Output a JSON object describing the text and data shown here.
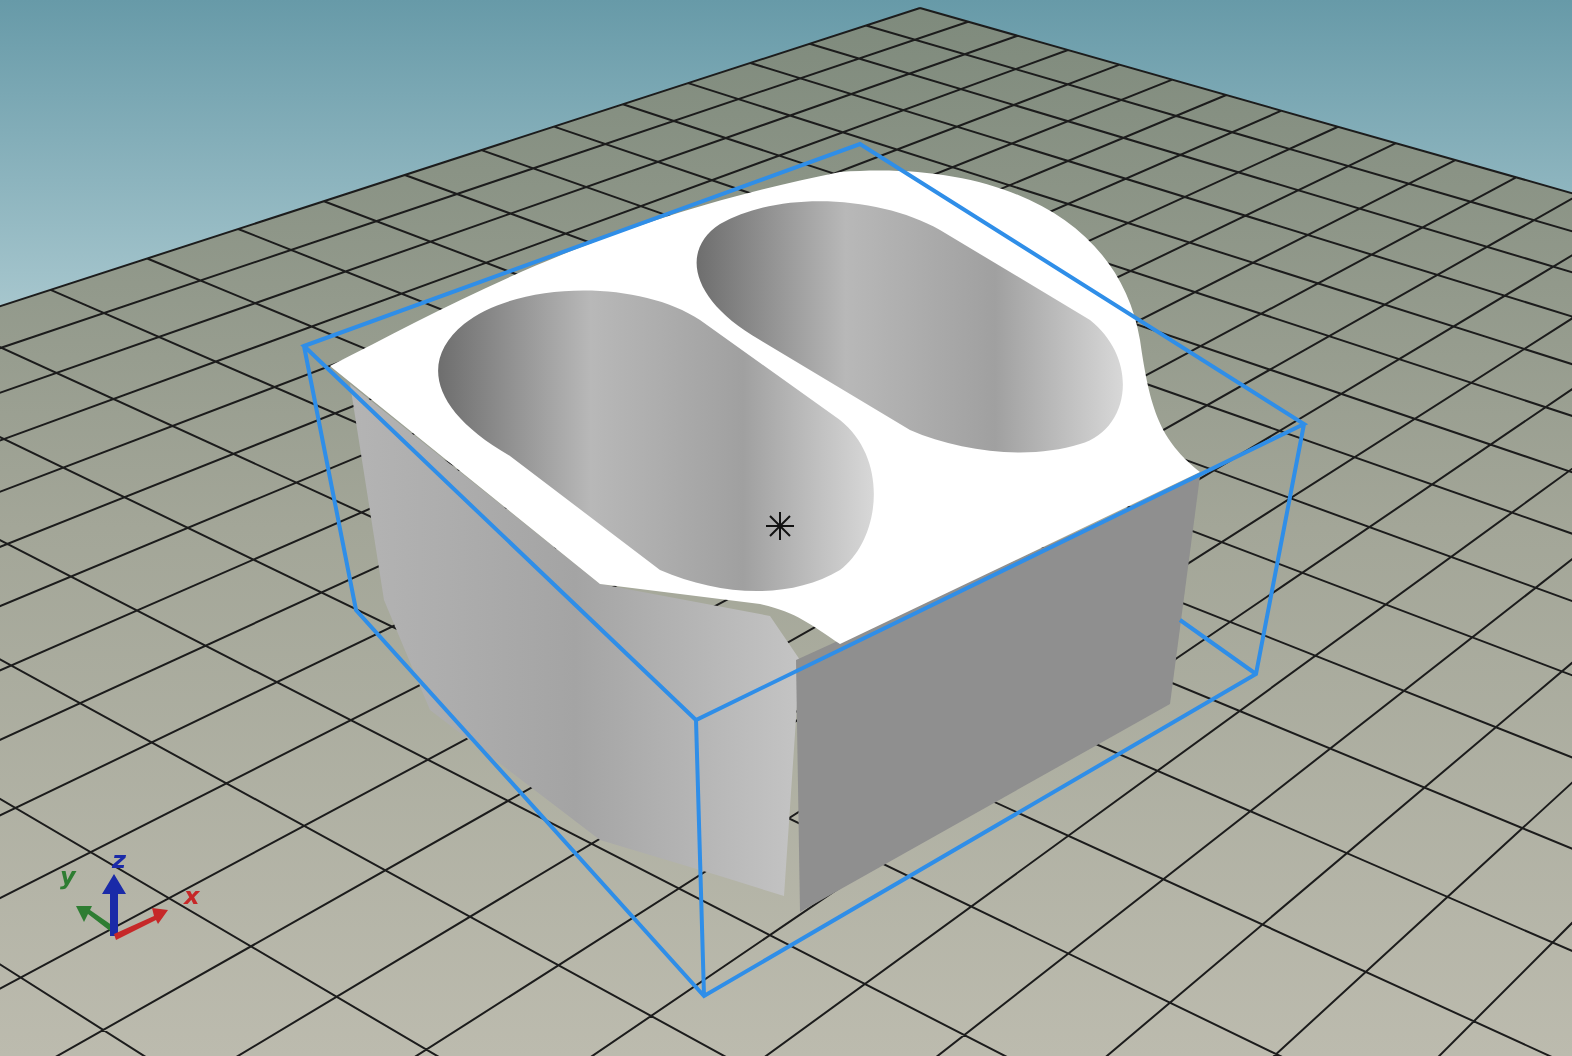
{
  "viewport": {
    "axes": [
      {
        "kind": "y",
        "label": "y",
        "color": "#2e7d32"
      },
      {
        "kind": "z",
        "label": "z",
        "color": "#1a2aa8"
      },
      {
        "kind": "x",
        "label": "x",
        "color": "#c62828"
      }
    ]
  }
}
